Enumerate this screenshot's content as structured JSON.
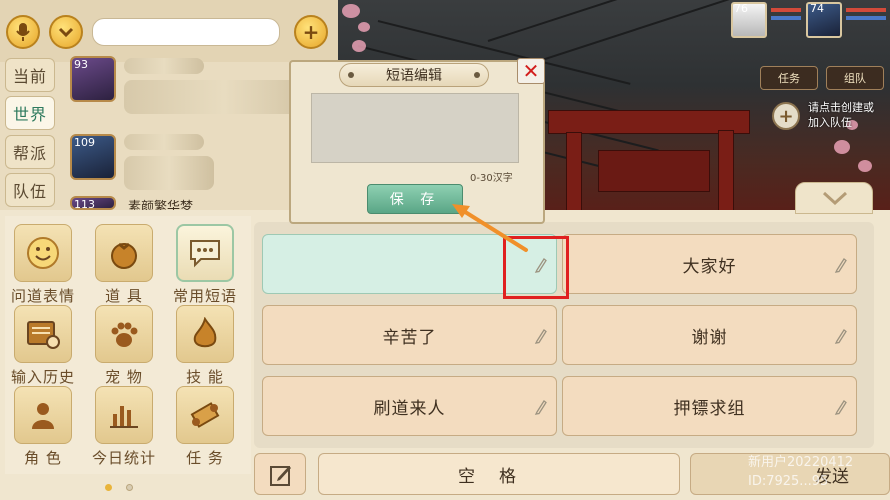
{
  "channels": {
    "tabs": [
      {
        "label": "当前"
      },
      {
        "label": "世界"
      },
      {
        "label": "帮派"
      },
      {
        "label": "队伍"
      }
    ]
  },
  "chat": {
    "messages": [
      {
        "level": "93"
      },
      {
        "level": "109"
      },
      {
        "level": "113",
        "sender": "素颜繁华梦"
      }
    ]
  },
  "dialog": {
    "title": "短语编辑",
    "close_icon": "close-x-icon",
    "char_limit": "0-30汉字",
    "save_label": "保 存"
  },
  "categories": [
    {
      "label": "问道表情",
      "icon": "smiley-icon"
    },
    {
      "label": "道 具",
      "icon": "item-bag-icon"
    },
    {
      "label": "常用短语",
      "icon": "chat-bubble-icon",
      "active": true
    },
    {
      "label": "输入历史",
      "icon": "history-icon"
    },
    {
      "label": "宠 物",
      "icon": "paw-icon"
    },
    {
      "label": "技 能",
      "icon": "flame-icon"
    },
    {
      "label": "角 色",
      "icon": "person-icon"
    },
    {
      "label": "今日统计",
      "icon": "bar-chart-icon"
    },
    {
      "label": "任 务",
      "icon": "scroll-icon"
    }
  ],
  "phrases": [
    {
      "label": "",
      "selected": true
    },
    {
      "label": "大家好"
    },
    {
      "label": "辛苦了"
    },
    {
      "label": "谢谢"
    },
    {
      "label": "刷道来人"
    },
    {
      "label": "押镖求组"
    }
  ],
  "input_row": {
    "space_label": "空格",
    "send_label": "发送"
  },
  "hud": {
    "player_levels": [
      "76",
      "74"
    ],
    "task_label": "任务",
    "team_label": "组队",
    "team_hint": "请点击创建或加入队伍"
  },
  "watermark": {
    "line1": "新用户20220412",
    "line2": "ID:7925...95"
  },
  "colors": {
    "accent_green": "#5aa686",
    "annotation_red": "#e02020",
    "annotation_arrow": "#f0902a"
  }
}
